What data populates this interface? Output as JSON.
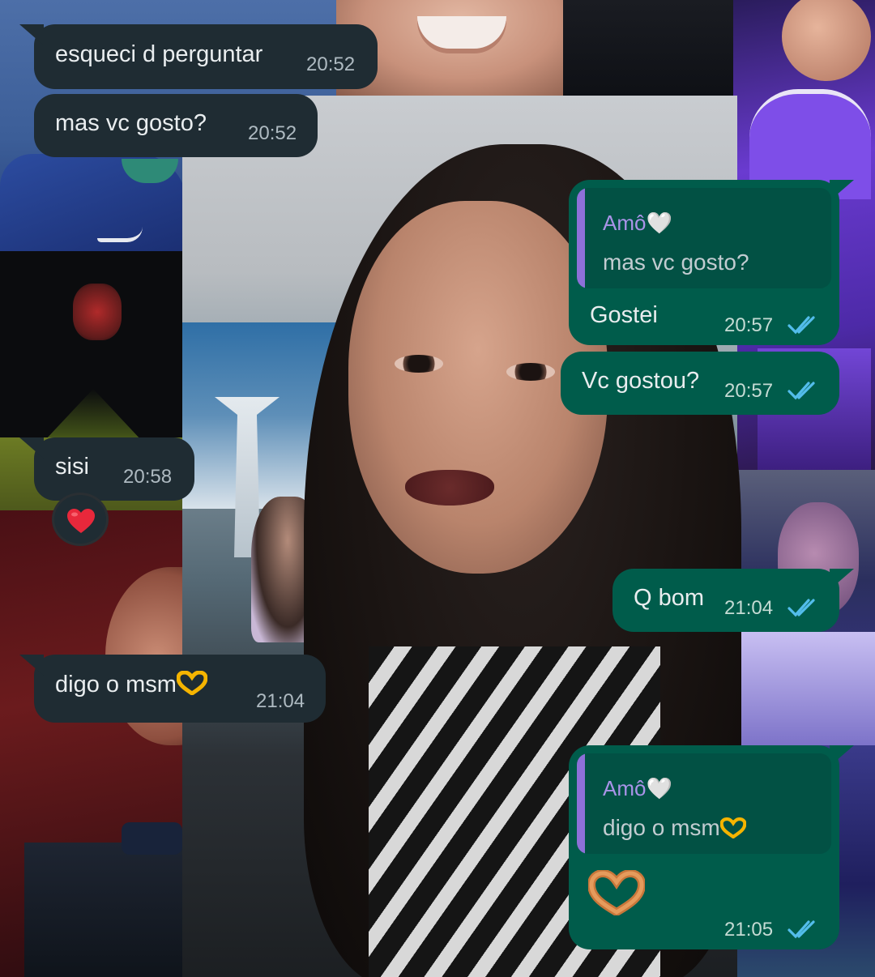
{
  "chat": {
    "messages": [
      {
        "id": "m1",
        "direction": "in",
        "text": "esqueci d perguntar",
        "time": "20:52"
      },
      {
        "id": "m2",
        "direction": "in",
        "text": "mas vc gosto?",
        "time": "20:52"
      },
      {
        "id": "m3",
        "direction": "out",
        "quote": {
          "author": "Amô🤍",
          "text": "mas vc gosto?"
        },
        "text": "Gostei",
        "time": "20:57",
        "status": "read"
      },
      {
        "id": "m4",
        "direction": "out",
        "text": "Vc gostou?",
        "time": "20:57",
        "status": "read"
      },
      {
        "id": "m5",
        "direction": "in",
        "text": "sisi",
        "time": "20:58",
        "reaction": "red-heart"
      },
      {
        "id": "m6",
        "direction": "out",
        "text": "Q bom",
        "time": "21:04",
        "status": "read"
      },
      {
        "id": "m7",
        "direction": "in",
        "text": "digo o msm",
        "emoji": "heart-hands",
        "time": "21:04"
      },
      {
        "id": "m8",
        "direction": "out",
        "quote": {
          "author": "Amô🤍",
          "text": "digo o msm"
        },
        "emoji": "heart-hands",
        "time": "21:05",
        "status": "read"
      }
    ]
  },
  "colors": {
    "incoming_bubble": "#1f2c33",
    "outgoing_bubble": "#005c4b",
    "read_ticks": "#53bdeb",
    "quote_bar": "#8d70d8"
  }
}
